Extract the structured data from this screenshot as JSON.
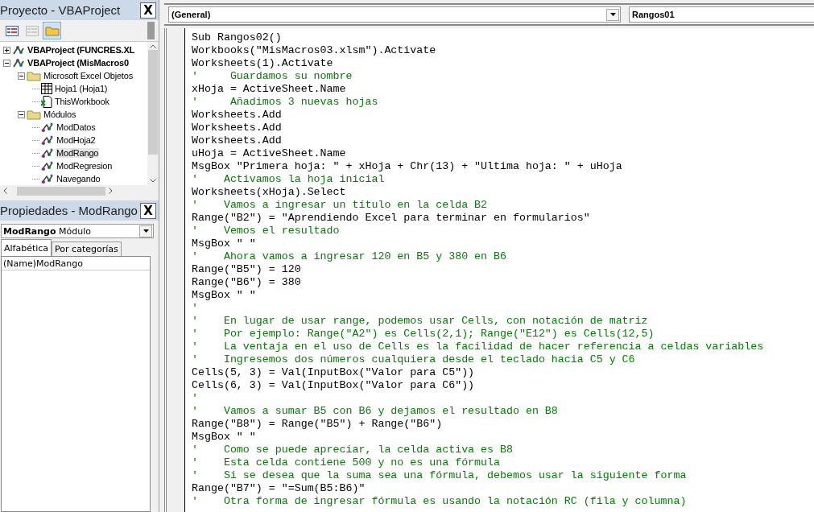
{
  "project": {
    "title": "Proyecto - VBAProject",
    "close": "X",
    "toolbar": [
      {
        "kind": "code",
        "disabled": false,
        "selected": false
      },
      {
        "kind": "object",
        "disabled": true,
        "selected": false
      },
      {
        "kind": "folders",
        "disabled": false,
        "selected": true
      }
    ],
    "tree": [
      {
        "label": "VBAProject (FUNCRES.XL",
        "kind": "project",
        "bold": true,
        "expanded": false,
        "selected": false
      },
      {
        "label": "VBAProject (MisMacros0",
        "kind": "project",
        "bold": true,
        "expanded": true,
        "selected": false,
        "children": [
          {
            "label": "Microsoft Excel Objetos",
            "kind": "folder",
            "bold": false,
            "expanded": true,
            "selected": false,
            "children": [
              {
                "label": "Hoja1 (Hoja1)",
                "kind": "sheet",
                "bold": false,
                "selected": false
              },
              {
                "label": "ThisWorkbook",
                "kind": "workbook",
                "bold": false,
                "selected": false
              }
            ]
          },
          {
            "label": "Módulos",
            "kind": "folder",
            "bold": false,
            "expanded": true,
            "selected": false,
            "children": [
              {
                "label": "ModDatos",
                "kind": "module",
                "bold": false,
                "selected": false
              },
              {
                "label": "ModHoja2",
                "kind": "module",
                "bold": false,
                "selected": false
              },
              {
                "label": "ModRango",
                "kind": "module",
                "bold": false,
                "selected": true
              },
              {
                "label": "ModRegresion",
                "kind": "module",
                "bold": false,
                "selected": false
              },
              {
                "label": "Navegando",
                "kind": "module",
                "bold": false,
                "selected": false
              }
            ]
          }
        ]
      }
    ]
  },
  "properties": {
    "title": "Propiedades - ModRango",
    "close": "X",
    "object_name": "ModRango",
    "object_type": "Módulo",
    "tabs": [
      {
        "label": "Alfabética",
        "selected": true
      },
      {
        "label": "Por categorías",
        "selected": false
      }
    ],
    "rows": [
      {
        "name": "(Name)",
        "value": "ModRango"
      }
    ]
  },
  "editor": {
    "object_combo": "(General)",
    "procedure_combo": "Rangos01",
    "lines": [
      {
        "kind": "code",
        "text": "Sub Rangos02()"
      },
      {
        "kind": "code",
        "text": "Workbooks(\"MisMacros03.xlsm\").Activate"
      },
      {
        "kind": "code",
        "text": "Worksheets(1).Activate"
      },
      {
        "kind": "comment",
        "text": "'     Guardamos su nombre"
      },
      {
        "kind": "code",
        "text": "xHoja = ActiveSheet.Name"
      },
      {
        "kind": "comment",
        "text": "'     Añadimos 3 nuevas hojas"
      },
      {
        "kind": "code",
        "text": "Worksheets.Add"
      },
      {
        "kind": "code",
        "text": "Worksheets.Add"
      },
      {
        "kind": "code",
        "text": "Worksheets.Add"
      },
      {
        "kind": "code",
        "text": "uHoja = ActiveSheet.Name"
      },
      {
        "kind": "code",
        "text": "MsgBox \"Primera hoja: \" + xHoja + Chr(13) + \"Ultima hoja: \" + uHoja"
      },
      {
        "kind": "comment",
        "text": "'    Activamos la hoja inicial"
      },
      {
        "kind": "code",
        "text": "Worksheets(xHoja).Select"
      },
      {
        "kind": "comment",
        "text": "'    Vamos a ingresar un título en la celda B2"
      },
      {
        "kind": "code",
        "text": "Range(\"B2\") = \"Aprendiendo Excel para terminar en formularios\""
      },
      {
        "kind": "comment",
        "text": "'    Vemos el resultado"
      },
      {
        "kind": "code",
        "text": "MsgBox \" \""
      },
      {
        "kind": "comment",
        "text": "'    Ahora vamos a ingresar 120 en B5 y 380 en B6"
      },
      {
        "kind": "code",
        "text": "Range(\"B5\") = 120"
      },
      {
        "kind": "code",
        "text": "Range(\"B6\") = 380"
      },
      {
        "kind": "code",
        "text": "MsgBox \" \""
      },
      {
        "kind": "comment",
        "text": "'"
      },
      {
        "kind": "comment",
        "text": "'    En lugar de usar range, podemos usar Cells, con notación de matriz"
      },
      {
        "kind": "comment",
        "text": "'    Por ejemplo: Range(\"A2\") es Cells(2,1); Range(\"E12\") es Cells(12,5)"
      },
      {
        "kind": "comment",
        "text": "'    La ventaja en el uso de Cells es la facilidad de hacer referencia a celdas variables"
      },
      {
        "kind": "comment",
        "text": "'    Ingresemos dos números cualquiera desde el teclado hacia C5 y C6"
      },
      {
        "kind": "code",
        "text": "Cells(5, 3) = Val(InputBox(\"Valor para C5\"))"
      },
      {
        "kind": "code",
        "text": "Cells(6, 3) = Val(InputBox(\"Valor para C6\"))"
      },
      {
        "kind": "comment",
        "text": "'"
      },
      {
        "kind": "comment",
        "text": "'    Vamos a sumar B5 con B6 y dejamos el resultado en B8"
      },
      {
        "kind": "code",
        "text": "Range(\"B8\") = Range(\"B5\") + Range(\"B6\")"
      },
      {
        "kind": "code",
        "text": "MsgBox \" \""
      },
      {
        "kind": "comment",
        "text": "'    Como se puede apreciar, la celda activa es B8"
      },
      {
        "kind": "comment",
        "text": "'    Esta celda contiene 500 y no es una fórmula"
      },
      {
        "kind": "comment",
        "text": "'    Si se desea que la suma sea una fórmula, debemos usar la siguiente forma"
      },
      {
        "kind": "code",
        "text": "Range(\"B7\") = \"=Sum(B5:B6)\""
      },
      {
        "kind": "comment",
        "text": "'    Otra forma de ingresar fórmula es usando la notación RC (fila y columna)"
      }
    ]
  }
}
